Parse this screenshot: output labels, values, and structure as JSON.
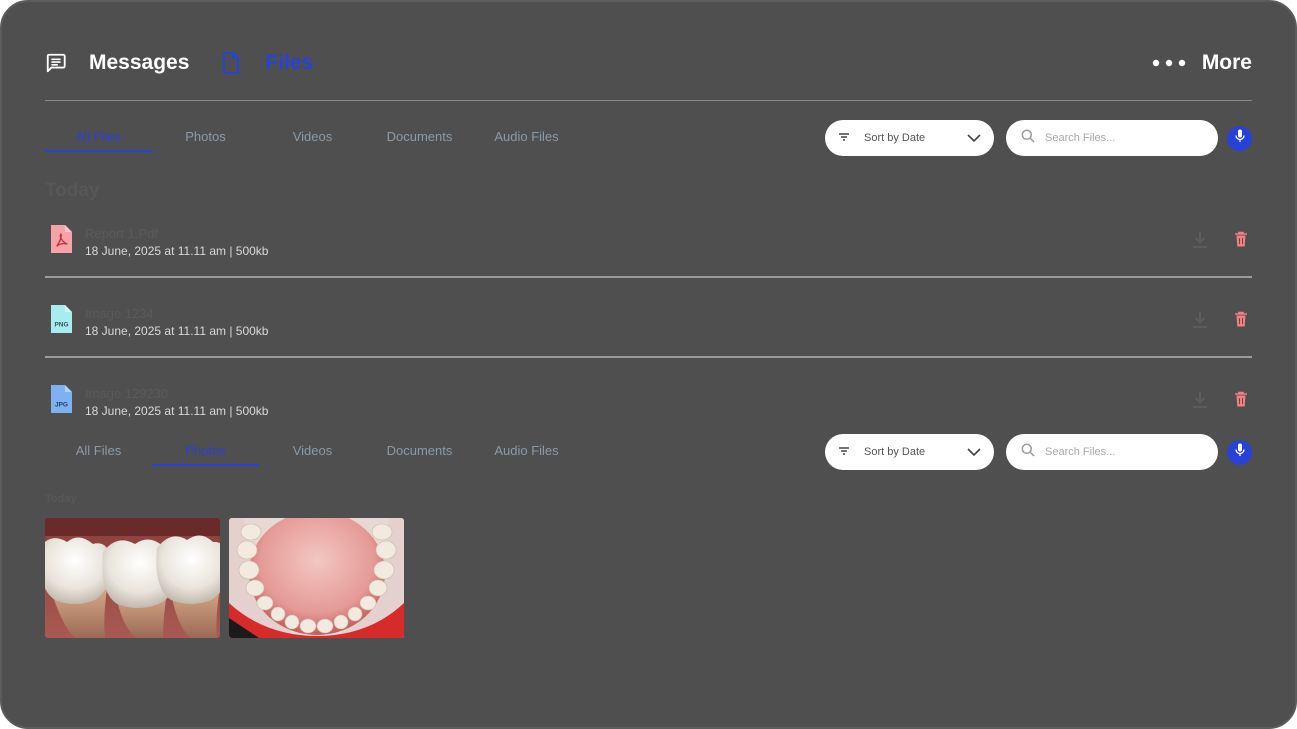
{
  "header": {
    "messages_label": "Messages",
    "files_label": "Files",
    "more_label": "More"
  },
  "tabs": [
    {
      "label": "All Files"
    },
    {
      "label": "Photos"
    },
    {
      "label": "Videos"
    },
    {
      "label": "Documents"
    },
    {
      "label": "Audio Files"
    }
  ],
  "toolbar_top": {
    "active_tab": "All Files",
    "sort_label": "Sort by Date",
    "search_placeholder": "Search Files..."
  },
  "toolbar_bottom": {
    "active_tab": "Photos",
    "sort_label": "Sort by Date",
    "search_placeholder": "Search Files..."
  },
  "files_section": {
    "title": "Today",
    "items": [
      {
        "name": "Report 1.Pdf",
        "meta": "18 June, 2025 at 11.11 am | 500kb",
        "type": "pdf",
        "badge": ""
      },
      {
        "name": "Image 1234",
        "meta": "18 June, 2025 at 11.11 am | 500kb",
        "type": "png",
        "badge": "PNG"
      },
      {
        "name": "Image 129230",
        "meta": "18 June, 2025 at 11.11 am | 500kb",
        "type": "jpg",
        "badge": "JPG"
      }
    ]
  },
  "photos_section": {
    "title": "Today",
    "photos": [
      {
        "subject": "molar-teeth-model"
      },
      {
        "subject": "upper-dental-arch"
      }
    ]
  },
  "colors": {
    "accent": "#2942d6",
    "pdf": "#f6a3a8",
    "png": "#a8ecef",
    "jpg": "#7fb0ef",
    "delete": "#f07f86"
  }
}
